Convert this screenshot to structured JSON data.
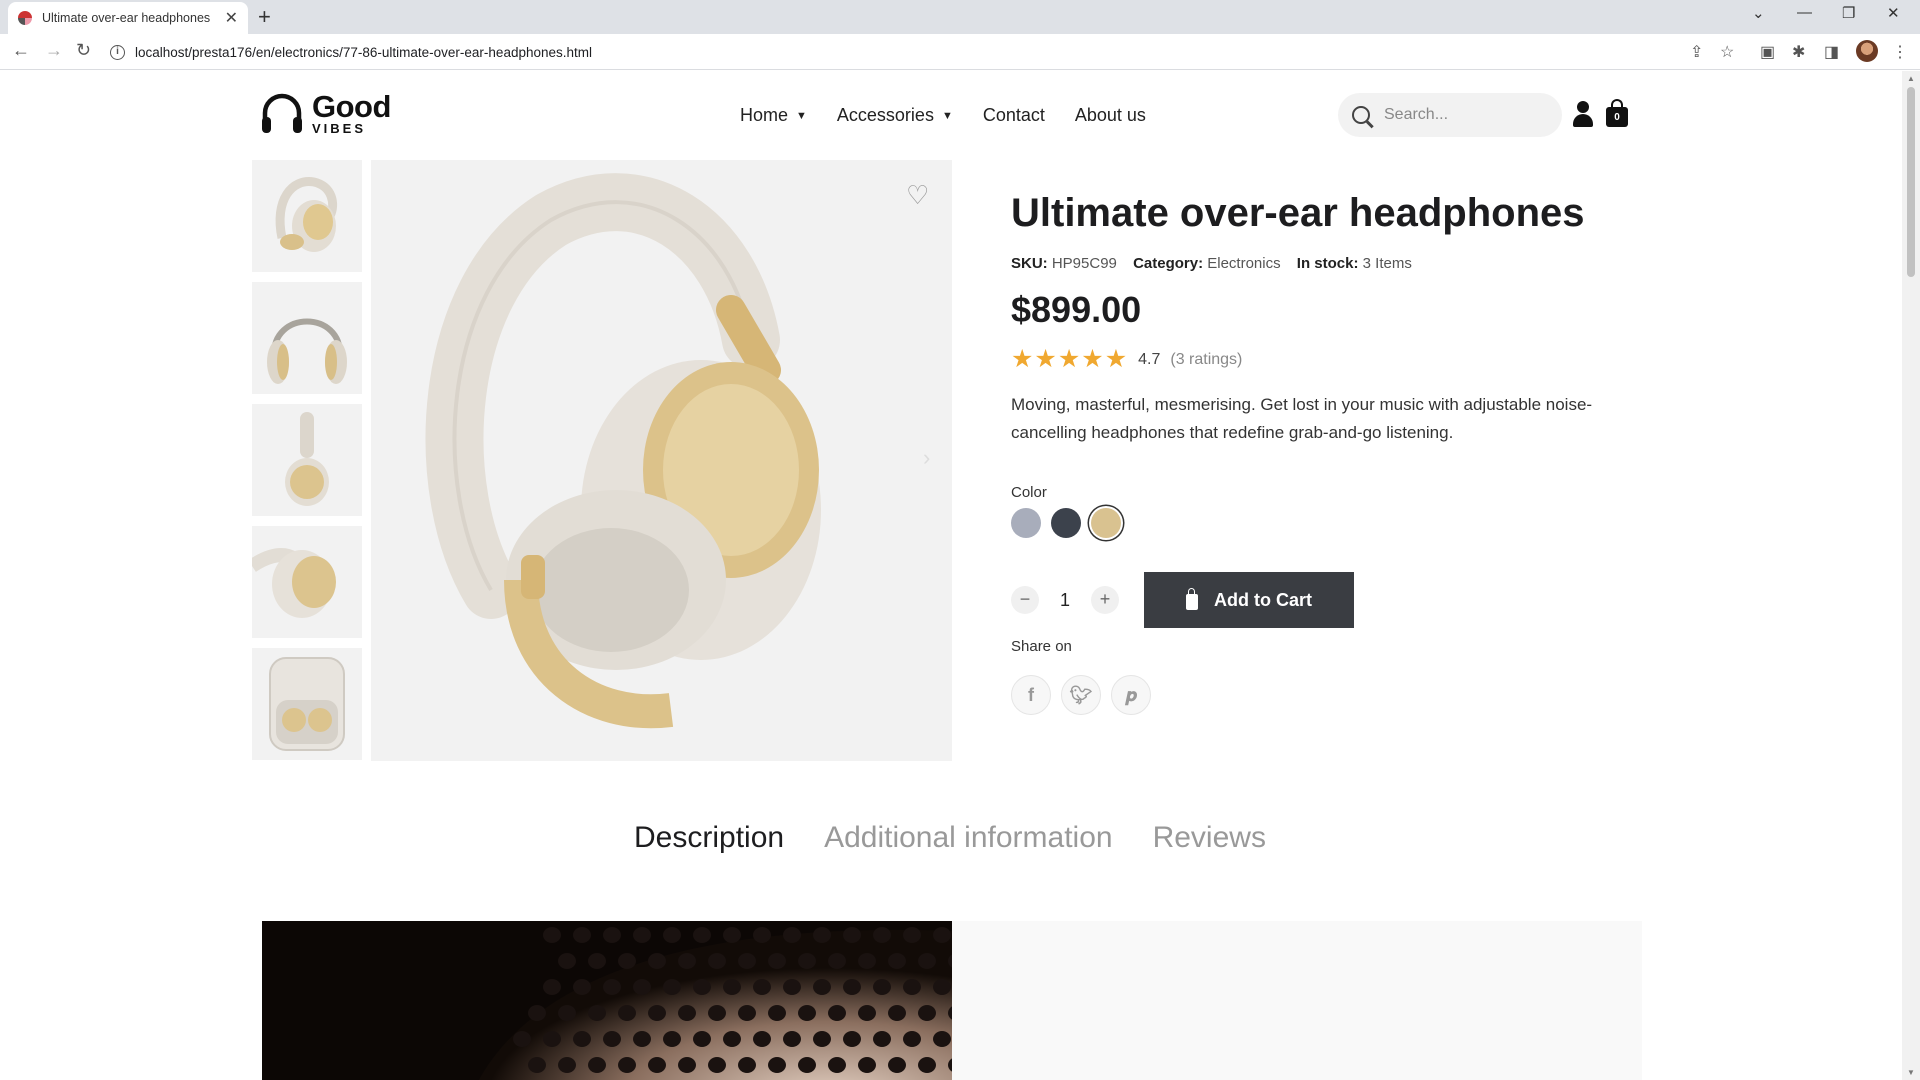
{
  "browser": {
    "tab_title": "Ultimate over-ear headphones",
    "url": "localhost/presta176/en/electronics/77-86-ultimate-over-ear-headphones.html"
  },
  "header": {
    "logo_top": "Good",
    "logo_bottom": "VIBES",
    "nav": [
      {
        "label": "Home",
        "has_dropdown": true
      },
      {
        "label": "Accessories",
        "has_dropdown": true
      },
      {
        "label": "Contact",
        "has_dropdown": false
      },
      {
        "label": "About us",
        "has_dropdown": false
      }
    ],
    "search_placeholder": "Search...",
    "cart_count": "0"
  },
  "product": {
    "title": "Ultimate over-ear headphones",
    "sku_label": "SKU:",
    "sku": "HP95C99",
    "category_label": "Category:",
    "category": "Electronics",
    "stock_label": "In stock:",
    "stock": "3 Items",
    "price": "$899.00",
    "rating_value": "4.7",
    "rating_count": "(3 ratings)",
    "stars": 5,
    "description": "Moving, masterful, mesmerising. Get lost in your music with adjustable noise-cancelling headphones that redefine grab-and-go listening.",
    "color_label": "Color",
    "colors": [
      "#a8adbb",
      "#3c424c",
      "#d9c290"
    ],
    "selected_color_index": 2,
    "quantity": "1",
    "add_to_cart": "Add to Cart",
    "share_label": "Share on",
    "share": [
      "facebook-icon",
      "twitter-icon",
      "pinterest-icon"
    ]
  },
  "tabs": [
    {
      "label": "Description",
      "active": true
    },
    {
      "label": "Additional information",
      "active": false
    },
    {
      "label": "Reviews",
      "active": false
    }
  ],
  "colors": {
    "accent_dark": "#3a3d42",
    "star": "#f0a830",
    "image_bg": "#f2f2f2"
  }
}
